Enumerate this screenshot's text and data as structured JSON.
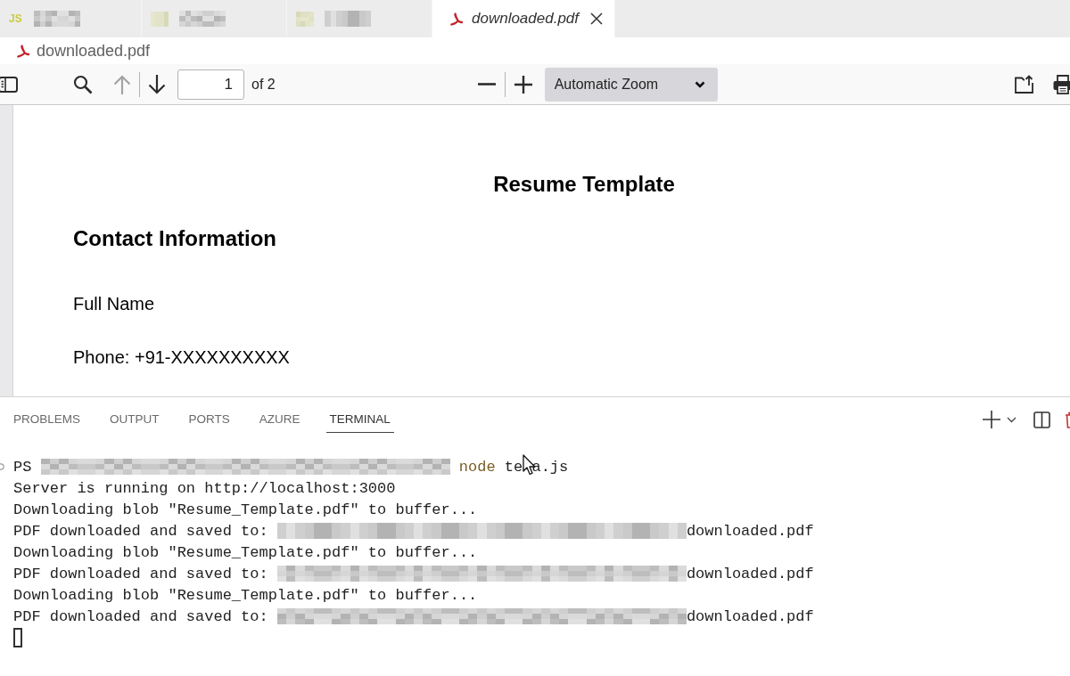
{
  "editor_tabs": [
    {
      "kind": "js",
      "icon_text": "JS",
      "selected": false
    },
    {
      "kind": "file",
      "selected": false
    },
    {
      "kind": "file",
      "selected": false
    },
    {
      "kind": "pdf",
      "label": "downloaded.pdf",
      "selected": true
    }
  ],
  "breadcrumb": {
    "label": "downloaded.pdf"
  },
  "pdf_toolbar": {
    "previous_page_disabled": true,
    "next_page_disabled": false,
    "page_number": "1",
    "page_count": "of 2",
    "zoom": "Automatic Zoom"
  },
  "document": {
    "title": "Resume Template",
    "heading": "Contact Information",
    "paragraphs": [
      "Full Name",
      "Phone: +91-XXXXXXXXXX"
    ]
  },
  "panel": {
    "tabs": [
      {
        "label": "PROBLEMS",
        "selected": false
      },
      {
        "label": "OUTPUT",
        "selected": false
      },
      {
        "label": "PORTS",
        "selected": false
      },
      {
        "label": "AZURE",
        "selected": false
      },
      {
        "label": "TERMINAL",
        "selected": true
      }
    ]
  },
  "terminal": {
    "lines": [
      {
        "kind": "prompt",
        "prompt": "PS",
        "command": "node",
        "argument_start": "te",
        "argument_end": "a.js"
      },
      {
        "kind": "output",
        "text": "Server is running on http://localhost:3000"
      },
      {
        "kind": "output",
        "text": "Downloading blob \"Resume_Template.pdf\" to buffer..."
      },
      {
        "kind": "saved",
        "text": "PDF downloaded and saved to:",
        "file": "downloaded.pdf"
      },
      {
        "kind": "output",
        "text": "Downloading blob \"Resume_Template.pdf\" to buffer..."
      },
      {
        "kind": "saved",
        "text": "PDF downloaded and saved to:",
        "file": "downloaded.pdf"
      },
      {
        "kind": "output",
        "text": "Downloading blob \"Resume_Template.pdf\" to buffer..."
      },
      {
        "kind": "saved",
        "text": "PDF downloaded and saved to:",
        "file": "downloaded.pdf"
      },
      {
        "kind": "cursor"
      }
    ]
  }
}
